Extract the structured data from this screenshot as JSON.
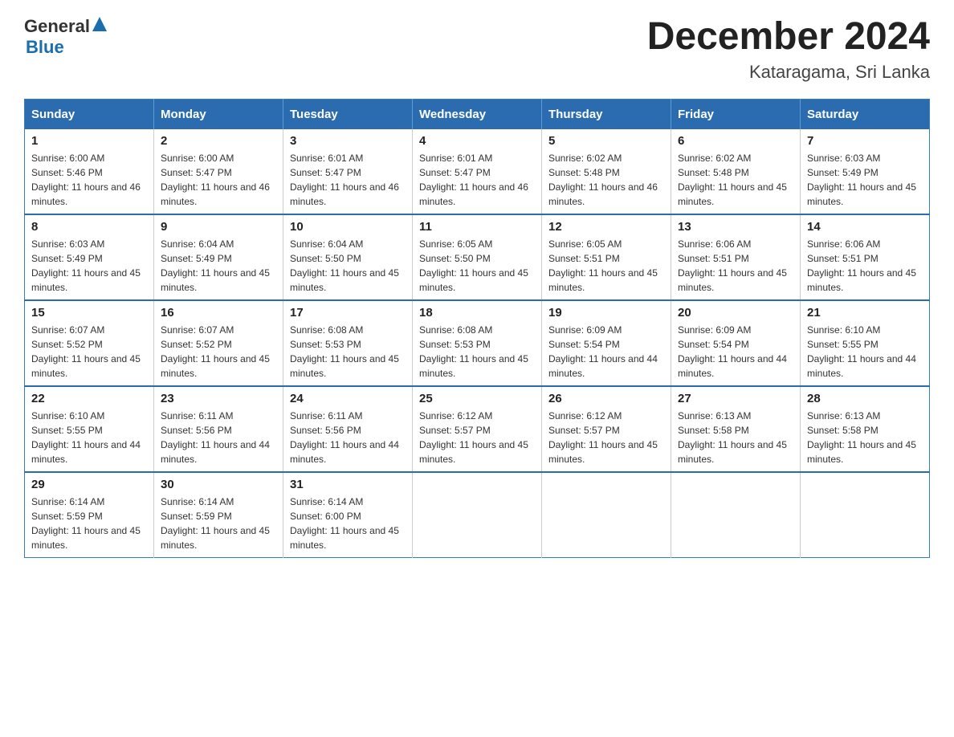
{
  "header": {
    "logo_general": "General",
    "logo_blue": "Blue",
    "title": "December 2024",
    "subtitle": "Kataragama, Sri Lanka"
  },
  "calendar": {
    "days_of_week": [
      "Sunday",
      "Monday",
      "Tuesday",
      "Wednesday",
      "Thursday",
      "Friday",
      "Saturday"
    ],
    "weeks": [
      [
        {
          "num": "1",
          "sunrise": "6:00 AM",
          "sunset": "5:46 PM",
          "daylight": "11 hours and 46 minutes."
        },
        {
          "num": "2",
          "sunrise": "6:00 AM",
          "sunset": "5:47 PM",
          "daylight": "11 hours and 46 minutes."
        },
        {
          "num": "3",
          "sunrise": "6:01 AM",
          "sunset": "5:47 PM",
          "daylight": "11 hours and 46 minutes."
        },
        {
          "num": "4",
          "sunrise": "6:01 AM",
          "sunset": "5:47 PM",
          "daylight": "11 hours and 46 minutes."
        },
        {
          "num": "5",
          "sunrise": "6:02 AM",
          "sunset": "5:48 PM",
          "daylight": "11 hours and 46 minutes."
        },
        {
          "num": "6",
          "sunrise": "6:02 AM",
          "sunset": "5:48 PM",
          "daylight": "11 hours and 45 minutes."
        },
        {
          "num": "7",
          "sunrise": "6:03 AM",
          "sunset": "5:49 PM",
          "daylight": "11 hours and 45 minutes."
        }
      ],
      [
        {
          "num": "8",
          "sunrise": "6:03 AM",
          "sunset": "5:49 PM",
          "daylight": "11 hours and 45 minutes."
        },
        {
          "num": "9",
          "sunrise": "6:04 AM",
          "sunset": "5:49 PM",
          "daylight": "11 hours and 45 minutes."
        },
        {
          "num": "10",
          "sunrise": "6:04 AM",
          "sunset": "5:50 PM",
          "daylight": "11 hours and 45 minutes."
        },
        {
          "num": "11",
          "sunrise": "6:05 AM",
          "sunset": "5:50 PM",
          "daylight": "11 hours and 45 minutes."
        },
        {
          "num": "12",
          "sunrise": "6:05 AM",
          "sunset": "5:51 PM",
          "daylight": "11 hours and 45 minutes."
        },
        {
          "num": "13",
          "sunrise": "6:06 AM",
          "sunset": "5:51 PM",
          "daylight": "11 hours and 45 minutes."
        },
        {
          "num": "14",
          "sunrise": "6:06 AM",
          "sunset": "5:51 PM",
          "daylight": "11 hours and 45 minutes."
        }
      ],
      [
        {
          "num": "15",
          "sunrise": "6:07 AM",
          "sunset": "5:52 PM",
          "daylight": "11 hours and 45 minutes."
        },
        {
          "num": "16",
          "sunrise": "6:07 AM",
          "sunset": "5:52 PM",
          "daylight": "11 hours and 45 minutes."
        },
        {
          "num": "17",
          "sunrise": "6:08 AM",
          "sunset": "5:53 PM",
          "daylight": "11 hours and 45 minutes."
        },
        {
          "num": "18",
          "sunrise": "6:08 AM",
          "sunset": "5:53 PM",
          "daylight": "11 hours and 45 minutes."
        },
        {
          "num": "19",
          "sunrise": "6:09 AM",
          "sunset": "5:54 PM",
          "daylight": "11 hours and 44 minutes."
        },
        {
          "num": "20",
          "sunrise": "6:09 AM",
          "sunset": "5:54 PM",
          "daylight": "11 hours and 44 minutes."
        },
        {
          "num": "21",
          "sunrise": "6:10 AM",
          "sunset": "5:55 PM",
          "daylight": "11 hours and 44 minutes."
        }
      ],
      [
        {
          "num": "22",
          "sunrise": "6:10 AM",
          "sunset": "5:55 PM",
          "daylight": "11 hours and 44 minutes."
        },
        {
          "num": "23",
          "sunrise": "6:11 AM",
          "sunset": "5:56 PM",
          "daylight": "11 hours and 44 minutes."
        },
        {
          "num": "24",
          "sunrise": "6:11 AM",
          "sunset": "5:56 PM",
          "daylight": "11 hours and 44 minutes."
        },
        {
          "num": "25",
          "sunrise": "6:12 AM",
          "sunset": "5:57 PM",
          "daylight": "11 hours and 45 minutes."
        },
        {
          "num": "26",
          "sunrise": "6:12 AM",
          "sunset": "5:57 PM",
          "daylight": "11 hours and 45 minutes."
        },
        {
          "num": "27",
          "sunrise": "6:13 AM",
          "sunset": "5:58 PM",
          "daylight": "11 hours and 45 minutes."
        },
        {
          "num": "28",
          "sunrise": "6:13 AM",
          "sunset": "5:58 PM",
          "daylight": "11 hours and 45 minutes."
        }
      ],
      [
        {
          "num": "29",
          "sunrise": "6:14 AM",
          "sunset": "5:59 PM",
          "daylight": "11 hours and 45 minutes."
        },
        {
          "num": "30",
          "sunrise": "6:14 AM",
          "sunset": "5:59 PM",
          "daylight": "11 hours and 45 minutes."
        },
        {
          "num": "31",
          "sunrise": "6:14 AM",
          "sunset": "6:00 PM",
          "daylight": "11 hours and 45 minutes."
        },
        null,
        null,
        null,
        null
      ]
    ]
  }
}
